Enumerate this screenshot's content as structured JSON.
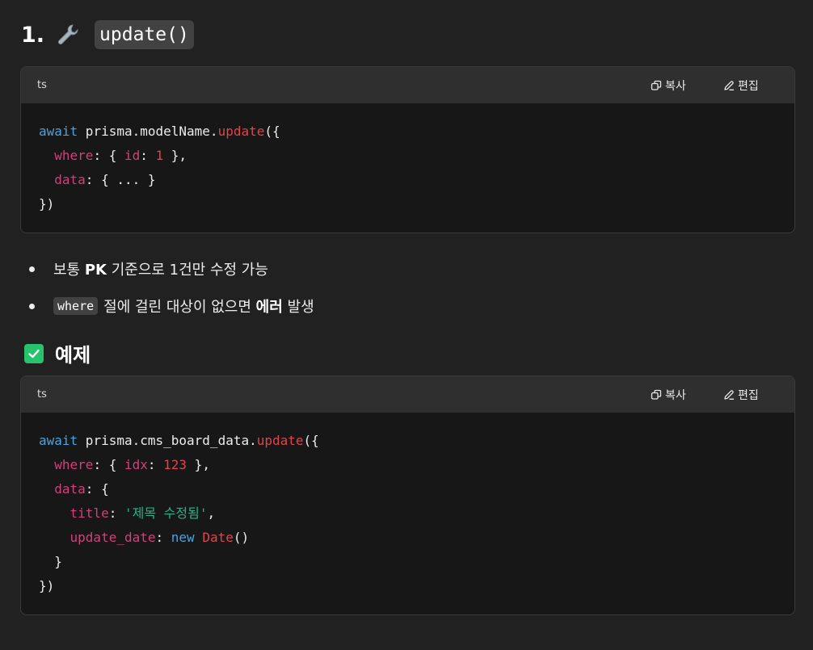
{
  "heading": {
    "number": "1.",
    "icon": "wrench-icon",
    "code": "update()"
  },
  "code_block_1": {
    "language": "ts",
    "copy_label": "복사",
    "edit_label": "편집",
    "lines": [
      "await prisma.modelName.update({",
      "  where: { id: 1 },",
      "  data: { ... }",
      "})"
    ]
  },
  "bullets": [
    {
      "prefix": "보통 ",
      "bold": "PK",
      "suffix": " 기준으로 1건만 수정 가능"
    },
    {
      "code": "where",
      "prefix": "절에 걸린 대상이 없으면 ",
      "bold": "에러",
      "suffix": " 발생"
    }
  ],
  "section": {
    "icon": "check-mark-icon",
    "title": "예제"
  },
  "code_block_2": {
    "language": "ts",
    "copy_label": "복사",
    "edit_label": "편집",
    "lines": [
      "await prisma.cms_board_data.update({",
      "  where: { idx: 123 },",
      "  data: {",
      "    title: '제목 수정됨',",
      "    update_date: new Date()",
      "  }",
      "})"
    ]
  },
  "colors": {
    "background": "#212121",
    "code_bg": "#171717",
    "bar_bg": "#2f2f2f",
    "keyword": "#4aa3df",
    "function": "#e0434e",
    "property": "#d2407a",
    "string": "#1fb789",
    "check": "#27c26c"
  }
}
